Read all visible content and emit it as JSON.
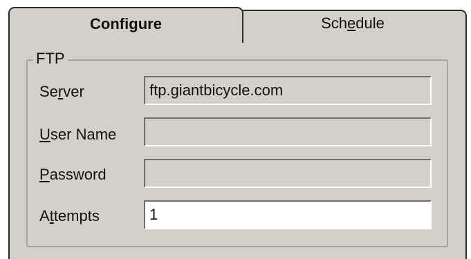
{
  "tabs": [
    {
      "label": "Configure",
      "selected": true
    },
    {
      "label": "Schedule",
      "selected": false
    }
  ],
  "group": {
    "label": "FTP"
  },
  "fields": {
    "server": {
      "label": "Server",
      "value": "ftp.giantbicycle.com"
    },
    "user_name": {
      "label": "User Name",
      "value": ""
    },
    "password": {
      "label": "Password",
      "value": ""
    },
    "attempts": {
      "label": "Attempts",
      "value": "1"
    }
  }
}
